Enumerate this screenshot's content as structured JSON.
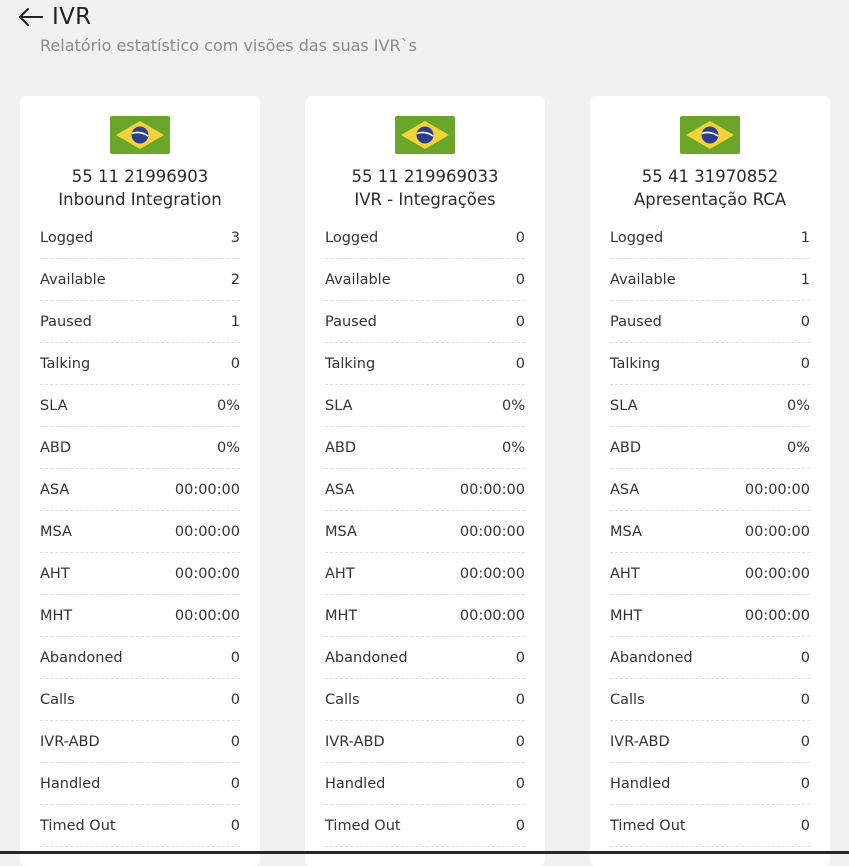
{
  "header": {
    "title": "IVR",
    "subtitle": "Relatório estatístico com visões das suas IVR`s"
  },
  "colors": {
    "flag_green": "#6aa62a",
    "flag_yellow": "#f4d23a",
    "flag_blue": "#2c3f8f"
  },
  "cards": [
    {
      "phone": "55 11 21996903",
      "name": "Inbound Integration",
      "stats": [
        {
          "label": "Logged",
          "value": "3"
        },
        {
          "label": "Available",
          "value": "2"
        },
        {
          "label": "Paused",
          "value": "1"
        },
        {
          "label": "Talking",
          "value": "0"
        },
        {
          "label": "SLA",
          "value": "0%"
        },
        {
          "label": "ABD",
          "value": "0%"
        },
        {
          "label": "ASA",
          "value": "00:00:00"
        },
        {
          "label": "MSA",
          "value": "00:00:00"
        },
        {
          "label": "AHT",
          "value": "00:00:00"
        },
        {
          "label": "MHT",
          "value": "00:00:00"
        },
        {
          "label": "Abandoned",
          "value": "0"
        },
        {
          "label": "Calls",
          "value": "0"
        },
        {
          "label": "IVR-ABD",
          "value": "0"
        },
        {
          "label": "Handled",
          "value": "0"
        },
        {
          "label": "Timed Out",
          "value": "0"
        }
      ]
    },
    {
      "phone": "55 11 219969033",
      "name": "IVR - Integrações",
      "stats": [
        {
          "label": "Logged",
          "value": "0"
        },
        {
          "label": "Available",
          "value": "0"
        },
        {
          "label": "Paused",
          "value": "0"
        },
        {
          "label": "Talking",
          "value": "0"
        },
        {
          "label": "SLA",
          "value": "0%"
        },
        {
          "label": "ABD",
          "value": "0%"
        },
        {
          "label": "ASA",
          "value": "00:00:00"
        },
        {
          "label": "MSA",
          "value": "00:00:00"
        },
        {
          "label": "AHT",
          "value": "00:00:00"
        },
        {
          "label": "MHT",
          "value": "00:00:00"
        },
        {
          "label": "Abandoned",
          "value": "0"
        },
        {
          "label": "Calls",
          "value": "0"
        },
        {
          "label": "IVR-ABD",
          "value": "0"
        },
        {
          "label": "Handled",
          "value": "0"
        },
        {
          "label": "Timed Out",
          "value": "0"
        }
      ]
    },
    {
      "phone": "55 41 31970852",
      "name": "Apresentação RCA",
      "stats": [
        {
          "label": "Logged",
          "value": "1"
        },
        {
          "label": "Available",
          "value": "1"
        },
        {
          "label": "Paused",
          "value": "0"
        },
        {
          "label": "Talking",
          "value": "0"
        },
        {
          "label": "SLA",
          "value": "0%"
        },
        {
          "label": "ABD",
          "value": "0%"
        },
        {
          "label": "ASA",
          "value": "00:00:00"
        },
        {
          "label": "MSA",
          "value": "00:00:00"
        },
        {
          "label": "AHT",
          "value": "00:00:00"
        },
        {
          "label": "MHT",
          "value": "00:00:00"
        },
        {
          "label": "Abandoned",
          "value": "0"
        },
        {
          "label": "Calls",
          "value": "0"
        },
        {
          "label": "IVR-ABD",
          "value": "0"
        },
        {
          "label": "Handled",
          "value": "0"
        },
        {
          "label": "Timed Out",
          "value": "0"
        }
      ]
    }
  ]
}
